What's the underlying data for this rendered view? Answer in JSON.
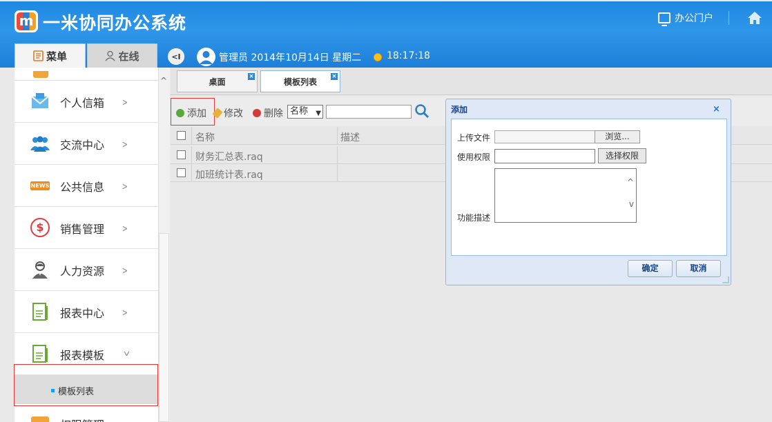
{
  "header": {
    "app_title": "一米协同办公系统",
    "logo_letter": "m",
    "portal_label": "办公门户"
  },
  "left_tabs": {
    "menu": "菜单",
    "online": "在线"
  },
  "userbar": {
    "collapse_symbol": "<I",
    "info": "管理员 2014年10月14日 星期二",
    "time": "18:17:18"
  },
  "sidebar": {
    "items": [
      {
        "label": "个人信箱",
        "icon": "envelope-icon"
      },
      {
        "label": "交流中心",
        "icon": "people-icon"
      },
      {
        "label": "公共信息",
        "icon": "news-icon",
        "badge": "NEWS"
      },
      {
        "label": "销售管理",
        "icon": "dollar-icon",
        "glyph": "$"
      },
      {
        "label": "人力资源",
        "icon": "person-icon"
      },
      {
        "label": "报表中心",
        "icon": "report-icon"
      },
      {
        "label": "报表模板",
        "icon": "report-template-icon",
        "expanded": true
      }
    ],
    "sub_item": "模板列表",
    "bottom_item": "权限管理"
  },
  "tabs": [
    {
      "label": "桌面",
      "active": false
    },
    {
      "label": "模板列表",
      "active": true
    }
  ],
  "toolbar": {
    "add": "添加",
    "edit": "修改",
    "delete": "删除",
    "field_select": "名称",
    "search_value": ""
  },
  "grid": {
    "columns": [
      "名称",
      "描述"
    ],
    "rows": [
      {
        "name": "财务汇总表.raq",
        "desc": ""
      },
      {
        "name": "加班统计表.raq",
        "desc": ""
      }
    ]
  },
  "dialog": {
    "title": "添加",
    "close_symbol": "×",
    "upload_label": "上传文件",
    "browse": "浏览...",
    "permission_label": "使用权限",
    "permission_value": "",
    "permission_button": "选择权限",
    "desc_label": "功能描述",
    "desc_value": "",
    "ok": "确定",
    "cancel": "取消"
  },
  "colors": {
    "header_blue": "#1d86e0",
    "highlight_red": "#e53535",
    "dialog_title": "#15428b"
  }
}
